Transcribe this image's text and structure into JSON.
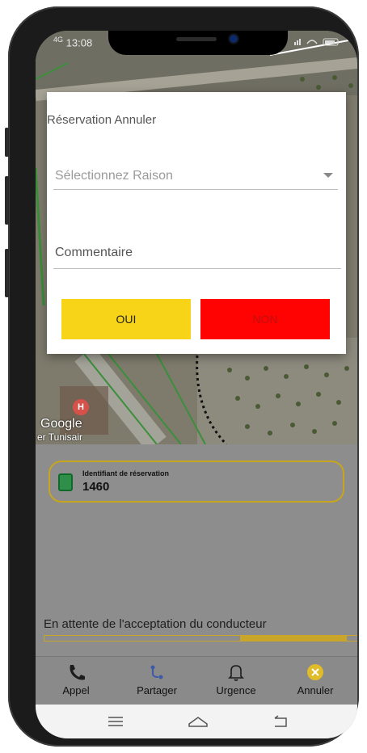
{
  "status_bar": {
    "network": "4G",
    "time": "13:08"
  },
  "map": {
    "attribution": "Google",
    "place_label": "er Tunisair",
    "poi_letter": "H"
  },
  "dialog": {
    "title": "Réservation Annuler",
    "reason_select": {
      "placeholder": "Sélectionnez Raison"
    },
    "comment_field": {
      "placeholder": "Commentaire",
      "value": ""
    },
    "yes_label": "OUI",
    "no_label": "NON",
    "colors": {
      "yes": "#f7d417",
      "no": "#ff0202"
    }
  },
  "booking": {
    "label": "Identifiant de réservation",
    "id": "1460"
  },
  "waiting": {
    "text": "En attente de l'acceptation du conducteur",
    "progress_fraction": 0.34
  },
  "action_bar": {
    "items": [
      {
        "label": "Appel",
        "icon": "phone-icon"
      },
      {
        "label": "Partager",
        "icon": "share-route-icon"
      },
      {
        "label": "Urgence",
        "icon": "bell-icon"
      },
      {
        "label": "Annuler",
        "icon": "cancel-circle-icon"
      }
    ]
  },
  "colors": {
    "accent": "#c9a62a"
  }
}
